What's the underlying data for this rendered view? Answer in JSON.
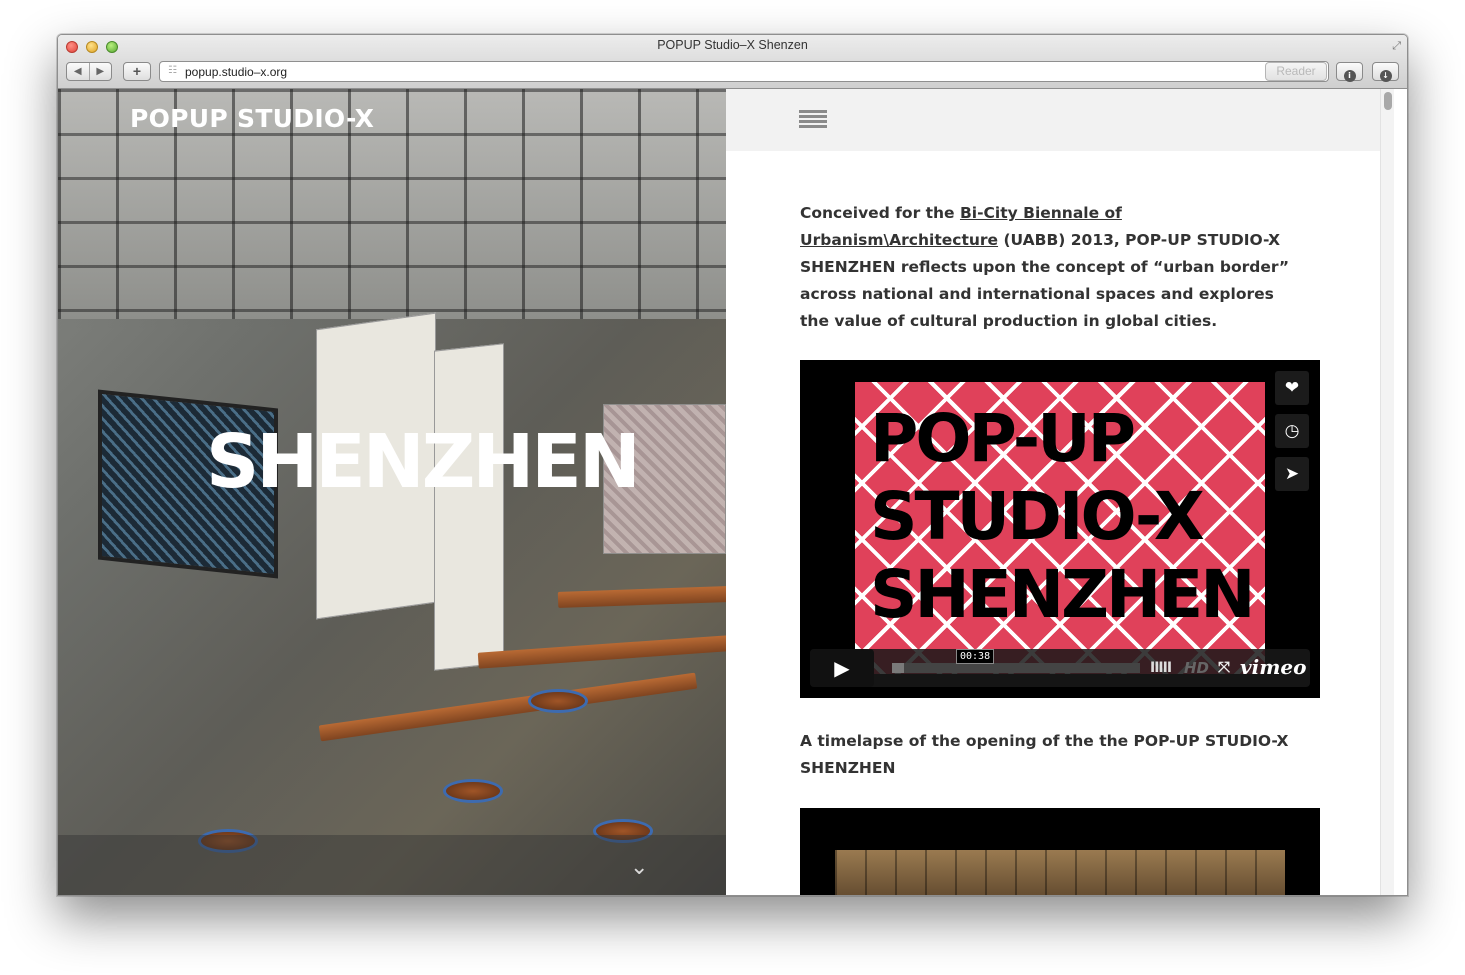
{
  "window": {
    "title": "POPUP Studio–X Shenzen"
  },
  "toolbar": {
    "back_icon": "◀",
    "forward_icon": "▶",
    "add_tab_label": "+",
    "url": "popup.studio–x.org",
    "reader_label": "Reader"
  },
  "hero": {
    "brand": "POPUP STUDIO-X",
    "city": "SHENZHEN"
  },
  "intro": {
    "prefix": "Conceived for the ",
    "link_text": "Bi-City Biennale of Urbanism\\Architecture",
    "suffix": " (UABB) 2013, POP-UP STUDIO-X SHENZHEN reflects upon the concept of “urban border” across national and international spaces and explores the value of cultural production in global cities."
  },
  "video1": {
    "thumb_text": "POP-UP STUDIO-X SHENZHEN",
    "time": "00:38",
    "hd_label": "HD",
    "brand": "vimeo",
    "progress": 0.05
  },
  "caption": "A timelapse of the opening of the the POP-UP STUDIO-X SHENZHEN",
  "colors": {
    "thumb_pink": "#e0415a",
    "chrome": "#d6d6d6"
  }
}
